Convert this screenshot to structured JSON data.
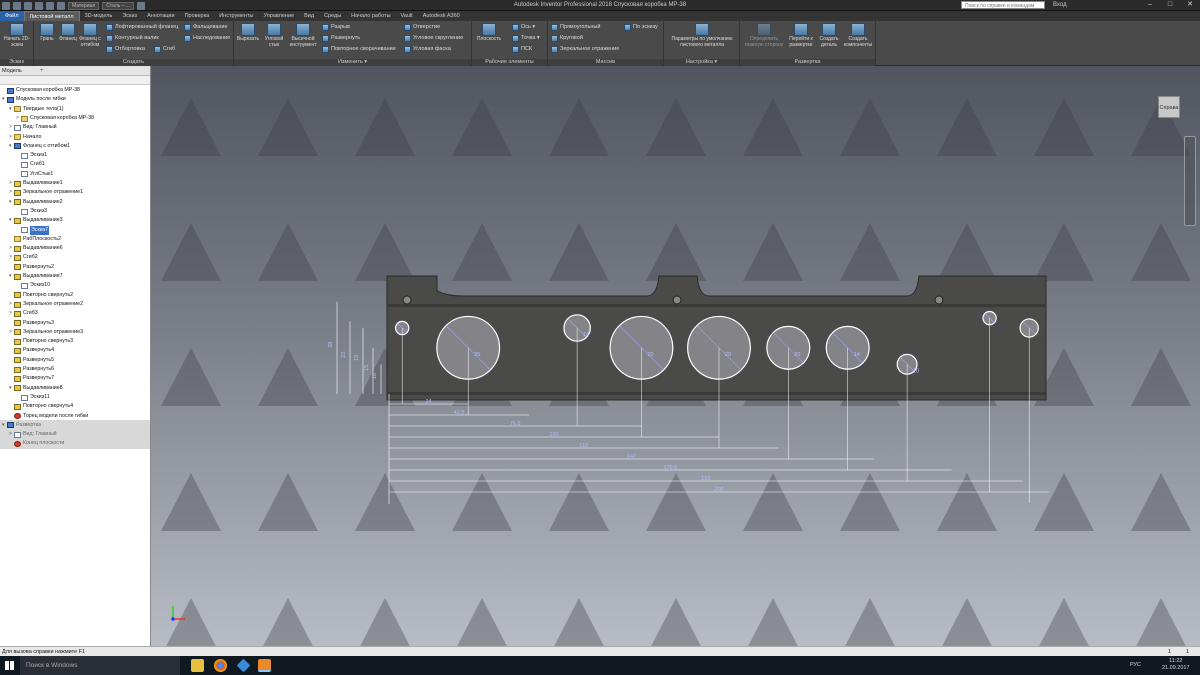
{
  "title": "Autodesk Inventor Professional 2018   Спусковая коробка МР-38",
  "qat": {
    "style_value": "Сталь – ...",
    "material_value": "Материал"
  },
  "search": {
    "placeholder": "Поиск по справке и командам"
  },
  "login": "Вход",
  "window_buttons": [
    "–",
    "□",
    "✕"
  ],
  "tabs": [
    "Файл",
    "Листовой металл",
    "3D-модель",
    "Эскиз",
    "Аннотации",
    "Проверка",
    "Инструменты",
    "Управление",
    "Вид",
    "Среды",
    "Начало работы",
    "Vault",
    "Autodesk A360"
  ],
  "ribbon": {
    "panels": {
      "sketch": "Эскиз",
      "create": "Создать",
      "modify": "Изменить ▾",
      "work": "Рабочие элементы",
      "pattern": "Массив",
      "setup": "Настройка ▾",
      "flat": "Развертка"
    },
    "sketch_btn": "Начать 2D-эскиз",
    "create_big": [
      "Грань",
      "Фланец",
      "Фланец с отгибом"
    ],
    "create_small": [
      "Лофтированный фланец",
      "Контурный валик",
      "Отбортовка",
      "Фальцевание",
      "Наследование",
      "Сгиб"
    ],
    "modify_big": [
      "Вырезать",
      "Угловой стык",
      "Высечной инструмент"
    ],
    "modify_small": [
      "Разрыв",
      "Развернуть",
      "Повторное сворачивание",
      "Отверстие",
      "Угловое скругление",
      "Угловая фаска"
    ],
    "work_big": "Плоскость",
    "work_small": [
      "Ось ▾",
      "Точка ▾",
      "ПСК"
    ],
    "pattern_small": [
      "Прямоугольный",
      "Круговой",
      "Зеркальное отражение",
      "По эскизу"
    ],
    "setup_big": "Параметры по умолчанию листового металла",
    "flat_big": [
      "Определить главную сторону",
      "Перейти к развертке",
      "Создать деталь",
      "Создать компоненты"
    ]
  },
  "browser": {
    "tab": "Модель",
    "tree": [
      {
        "label": "Спусковая коробка МР-38",
        "lvl": 0,
        "icon": "bd",
        "exp": ""
      },
      {
        "label": "Модель после гибки",
        "lvl": 0,
        "icon": "bd",
        "exp": "▾"
      },
      {
        "label": "Твердые тела(1)",
        "lvl": 1,
        "icon": "pl",
        "exp": "▾"
      },
      {
        "label": "Спусковая коробка МР-38",
        "lvl": 2,
        "icon": "pl",
        "exp": ">"
      },
      {
        "label": "Вид: Главный",
        "lvl": 1,
        "icon": "sk",
        "exp": ">"
      },
      {
        "label": "Начало",
        "lvl": 1,
        "icon": "pl",
        "exp": ">"
      },
      {
        "label": "Фланец с отгибом1",
        "lvl": 1,
        "icon": "bd",
        "exp": "▾"
      },
      {
        "label": "Эскиз1",
        "lvl": 2,
        "icon": "sk",
        "exp": ""
      },
      {
        "label": "Сгиб1",
        "lvl": 2,
        "icon": "sk",
        "exp": ""
      },
      {
        "label": "УглСтык1",
        "lvl": 2,
        "icon": "sk",
        "exp": ""
      },
      {
        "label": "Выдавливание1",
        "lvl": 1,
        "icon": "",
        "exp": ">"
      },
      {
        "label": "Зеркальное отражение1",
        "lvl": 1,
        "icon": "",
        "exp": ">"
      },
      {
        "label": "Выдавливание2",
        "lvl": 1,
        "icon": "",
        "exp": "▾"
      },
      {
        "label": "Эскиз3",
        "lvl": 2,
        "icon": "sk",
        "exp": ""
      },
      {
        "label": "Выдавливание3",
        "lvl": 1,
        "icon": "",
        "exp": "▾"
      },
      {
        "label": "Эскиз7",
        "lvl": 2,
        "icon": "sk",
        "exp": "",
        "sel": true
      },
      {
        "label": "РабПлоскость2",
        "lvl": 1,
        "icon": "pl",
        "exp": ""
      },
      {
        "label": "Выдавливание6",
        "lvl": 1,
        "icon": "",
        "exp": ">"
      },
      {
        "label": "Сгиб2",
        "lvl": 1,
        "icon": "",
        "exp": ">"
      },
      {
        "label": "Развернуть2",
        "lvl": 1,
        "icon": "",
        "exp": ""
      },
      {
        "label": "Выдавливание7",
        "lvl": 1,
        "icon": "",
        "exp": "▾"
      },
      {
        "label": "Эскиз10",
        "lvl": 2,
        "icon": "sk",
        "exp": ""
      },
      {
        "label": "Повторно свернуть2",
        "lvl": 1,
        "icon": "",
        "exp": ""
      },
      {
        "label": "Зеркальное отражение2",
        "lvl": 1,
        "icon": "",
        "exp": ">"
      },
      {
        "label": "Сгиб3",
        "lvl": 1,
        "icon": "",
        "exp": ">"
      },
      {
        "label": "Развернуть3",
        "lvl": 1,
        "icon": "",
        "exp": ""
      },
      {
        "label": "Зеркальное отражение3",
        "lvl": 1,
        "icon": "",
        "exp": ">"
      },
      {
        "label": "Повторно свернуть3",
        "lvl": 1,
        "icon": "",
        "exp": ""
      },
      {
        "label": "Развернуть4",
        "lvl": 1,
        "icon": "",
        "exp": ""
      },
      {
        "label": "Развернуть5",
        "lvl": 1,
        "icon": "",
        "exp": ""
      },
      {
        "label": "Развернуть6",
        "lvl": 1,
        "icon": "",
        "exp": ""
      },
      {
        "label": "Развернуть7",
        "lvl": 1,
        "icon": "",
        "exp": ""
      },
      {
        "label": "Выдавливание8",
        "lvl": 1,
        "icon": "",
        "exp": "▾"
      },
      {
        "label": "Эскиз11",
        "lvl": 2,
        "icon": "sk",
        "exp": ""
      },
      {
        "label": "Повторно свернуть4",
        "lvl": 1,
        "icon": "",
        "exp": ""
      },
      {
        "label": "Торец модели после гибки",
        "lvl": 1,
        "icon": "er",
        "exp": ""
      },
      {
        "label": "Развертка",
        "lvl": 0,
        "icon": "bd",
        "exp": "▾",
        "grey": true
      },
      {
        "label": "Вид: Главный",
        "lvl": 1,
        "icon": "sk",
        "exp": ">",
        "grey": true
      },
      {
        "label": "Конец плоскости",
        "lvl": 1,
        "icon": "er",
        "exp": "",
        "grey": true
      }
    ]
  },
  "viewcube": "Справа",
  "drawing": {
    "vert_dims": [
      "28",
      "22",
      "13",
      "15",
      "10"
    ],
    "horiz_dims": [
      "24",
      "42,5",
      "76,5",
      "100",
      "118",
      "147",
      "170,5",
      "192",
      "200"
    ],
    "hole_labels": [
      "25",
      "20",
      "20",
      "20",
      "14",
      "14",
      "10"
    ]
  },
  "status": {
    "message": "Для вызова справки нажмите F1",
    "count1": "1",
    "count2": "1"
  },
  "taskbar": {
    "search": "Поиск в Windows",
    "lang": "РУС",
    "time": "11:22",
    "date": "21.09.2017"
  }
}
